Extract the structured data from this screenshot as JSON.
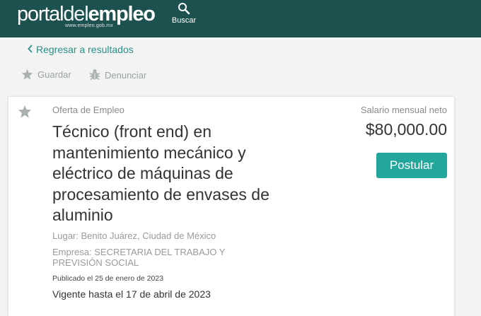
{
  "header": {
    "logo_part1": "portal",
    "logo_part2": "del",
    "logo_part3": "empleo",
    "logo_url_text": "www.empleo.gob.mx",
    "search_label": "Buscar",
    "search_icon": "search-icon",
    "background_color": "#1d5150"
  },
  "nav": {
    "back_label": "Regresar a resultados",
    "save_label": "Guardar",
    "report_label": "Denunciar"
  },
  "job": {
    "offer_type": "Oferta de Empleo",
    "title": "Técnico (front end) en mantenimiento mecánico y eléctrico de máquinas de procesamiento de envases de aluminio",
    "location": "Lugar: Benito Juárez, Ciudad de México",
    "company": "Empresa: SECRETARIA DEL TRABAJO Y PREVISIÓN SOCIAL",
    "published": "Publicado el 25 de enero de 2023",
    "valid_until": "Vigente hasta el 17 de abril de 2023",
    "salary_label": "Salario mensual neto",
    "salary": "$80,000.00",
    "apply_label": "Postular"
  },
  "colors": {
    "accent": "#23a69b",
    "link": "#2a8f87",
    "muted": "#9aa3a3"
  }
}
